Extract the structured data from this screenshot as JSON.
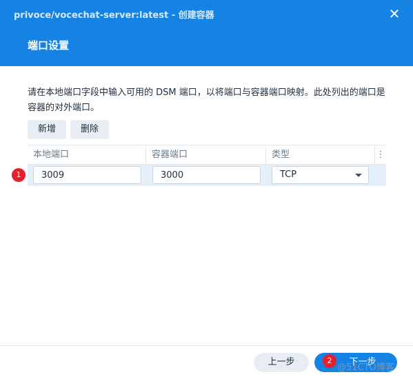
{
  "window": {
    "title": "privoce/vocechat-server:latest - 创建容器",
    "close_icon": "close-icon"
  },
  "page": {
    "title": "端口设置",
    "description": "请在本地端口字段中输入可用的 DSM 端口，以将端口与容器端口映射。此处列出的端口是容器的对外端口。"
  },
  "toolbar": {
    "add_label": "新增",
    "delete_label": "删除"
  },
  "table": {
    "columns": [
      "本地端口",
      "容器端口",
      "类型"
    ],
    "menu_icon": "more-vertical-icon",
    "rows": [
      {
        "local_port": "3009",
        "container_port": "3000",
        "type": "TCP"
      }
    ]
  },
  "badges": {
    "step1": "1",
    "step2": "2"
  },
  "footer": {
    "prev_label": "上一步",
    "next_label": "下一步"
  },
  "watermark": "@51CTO博客",
  "colors": {
    "header_bg": "#1583e4",
    "primary_button": "#1583e4",
    "badge": "#e4202c",
    "selected_row": "#e6f0fb"
  }
}
